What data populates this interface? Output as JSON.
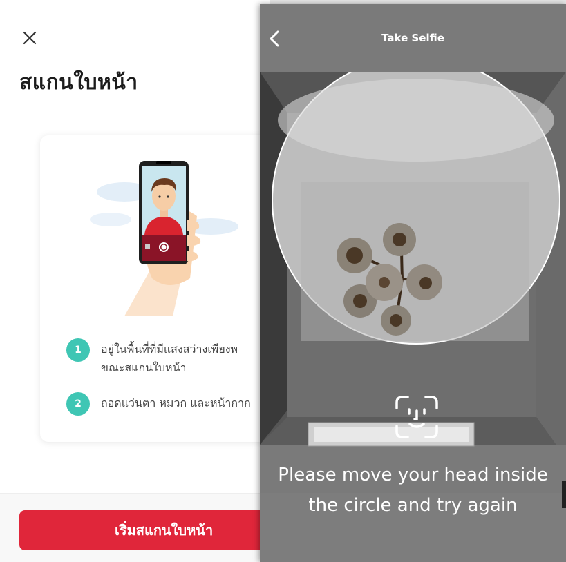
{
  "intro": {
    "title": "สแกนใบหน้า",
    "steps": [
      {
        "num": "1",
        "line1": "อยู่ในพื้นที่ที่มีแสงสว่างเพียงพ",
        "line2": "ขณะสแกนใบหน้า"
      },
      {
        "num": "2",
        "line1": "ถอดแว่นตา หมวก และหน้ากาก",
        "line2": ""
      }
    ],
    "start_button": "เริ่มสแกนใบหน้า"
  },
  "camera": {
    "title": "Take Selfie",
    "message_line1": "Please move your head inside",
    "message_line2": "the circle and try again"
  },
  "colors": {
    "accent_red": "#e0263a",
    "step_teal": "#3fc6b4"
  },
  "icons": [
    "close-icon",
    "back-chevron-icon",
    "face-scan-icon"
  ]
}
